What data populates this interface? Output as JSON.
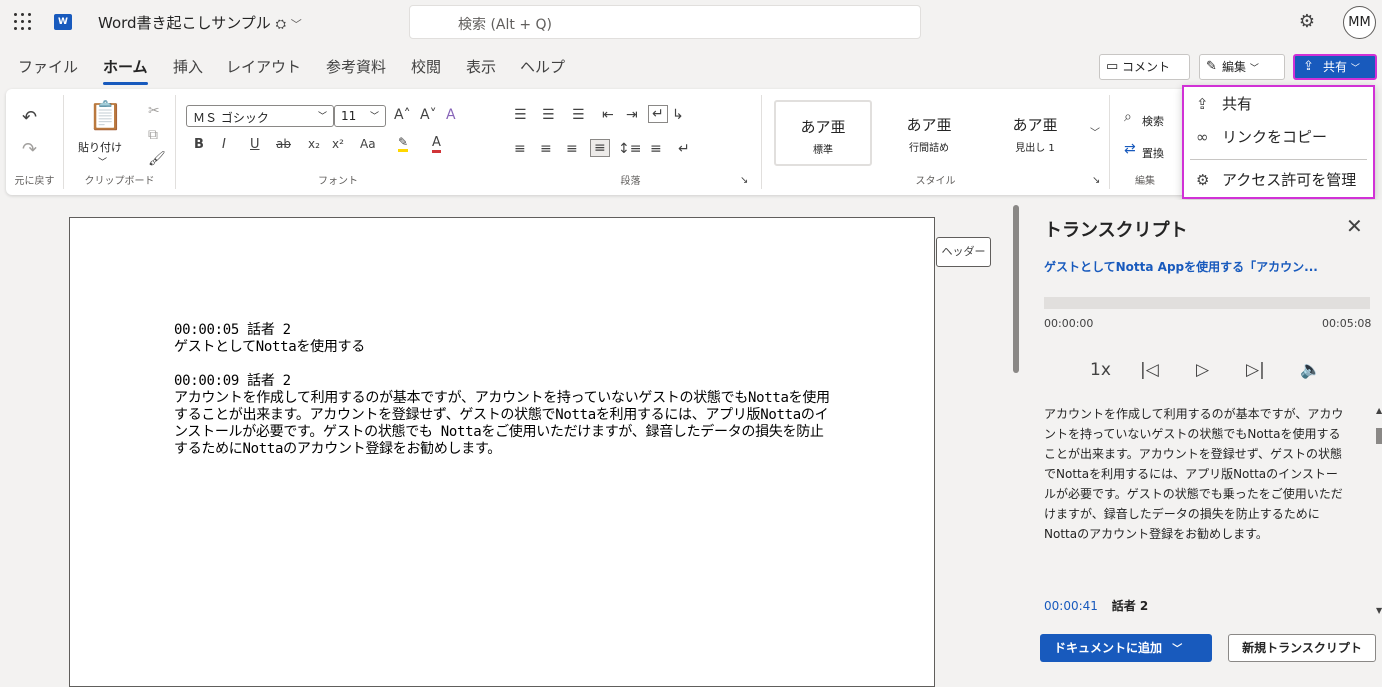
{
  "titlebar": {
    "doc_title": "Word書き起こしサンプル",
    "search_placeholder": "検索 (Alt + Q)",
    "avatar_initials": "MM"
  },
  "menu": {
    "tabs": [
      "ファイル",
      "ホーム",
      "挿入",
      "レイアウト",
      "参考資料",
      "校閲",
      "表示",
      "ヘルプ"
    ],
    "active_tab": "ホーム",
    "comment_label": "コメント",
    "edit_label": "編集",
    "share_label": "共有"
  },
  "ribbon": {
    "undo_group": "元に戻す",
    "paste_label": "貼り付け",
    "clipboard_group": "クリップボード",
    "font_name": "ＭＳ ゴシック",
    "font_size": "11",
    "font_group": "フォント",
    "paragraph_group": "段落",
    "styles": [
      {
        "glyph": "あア亜",
        "name": "標準"
      },
      {
        "glyph": "あア亜",
        "name": "行間詰め"
      },
      {
        "glyph": "あア亜",
        "name": "見出し 1"
      }
    ],
    "styles_group": "スタイル",
    "find_label": "検索",
    "replace_label": "置換",
    "editing_group": "編集"
  },
  "share_menu": {
    "items": [
      "共有",
      "リンクをコピー",
      "アクセス許可を管理"
    ]
  },
  "document": {
    "header_tag": "ヘッダー",
    "paragraphs": [
      "00:00:05 話者 2\nゲストとしてNottaを使用する",
      "00:00:09 話者 2\nアカウントを作成して利用するのが基本ですが、アカウントを持っていないゲストの状態でもNottaを使用することが出来ます。アカウントを登録せず、ゲストの状態でNottaを利用するには、アプリ版Nottaのインストールが必要です。ゲストの状態でも Nottaをご使用いただけますが、録音したデータの損失を防止するためにNottaのアカウント登録をお勧めします。"
    ]
  },
  "transcript": {
    "title": "トランスクリプト",
    "subtitle": "ゲストとしてNotta Appを使用する「アカウン...",
    "time_start": "00:00:00",
    "time_end": "00:05:08",
    "speed": "1x",
    "body": "アカウントを作成して利用するのが基本ですが、アカウントを持っていないゲストの状態でもNottaを使用することが出来ます。アカウントを登録せず、ゲストの状態でNottaを利用するには、アプリ版Nottaのインストールが必要です。ゲストの状態でも乗ったをご使用いただけますが、録音したデータの損失を防止するためにNottaのアカウント登録をお勧めします。",
    "next_timestamp": "00:00:41",
    "next_speaker": "話者 2",
    "add_button": "ドキュメントに追加",
    "new_button": "新規トランスクリプト"
  },
  "colors": {
    "accent": "#185abd",
    "highlight_border": "#d131d6"
  }
}
